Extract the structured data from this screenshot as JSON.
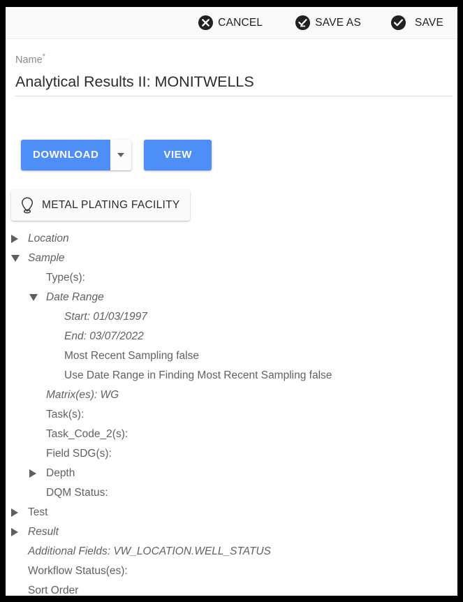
{
  "toolbar": {
    "buttons": [
      {
        "label": "CANCEL",
        "icon": "cancel-circle-icon"
      },
      {
        "label": "SAVE AS",
        "icon": "save-as-check-circle-icon"
      },
      {
        "label": "SAVE",
        "icon": "check-circle-icon"
      }
    ]
  },
  "name_field": {
    "label": "Name",
    "required_marker": "*",
    "value": "Analytical Results II: MONITWELLS",
    "placeholder": "Name"
  },
  "actions": {
    "download_label": "DOWNLOAD",
    "download_dropdown_icon": "chevron-down-icon",
    "view_label": "VIEW"
  },
  "facility_chip": {
    "label": "METAL PLATING FACILITY",
    "icon": "location-pin-icon"
  },
  "tree": {
    "nodes": [
      {
        "label": "Location",
        "indent": 0,
        "toggle": "collapsed",
        "italic": true
      },
      {
        "label": "Sample",
        "indent": 0,
        "toggle": "expanded",
        "italic": true
      },
      {
        "label": "Type(s):",
        "indent": 1,
        "toggle": "none",
        "italic": false
      },
      {
        "label": "Date Range",
        "indent": 1,
        "toggle": "expanded",
        "italic": true
      },
      {
        "label": "Start: 01/03/1997",
        "indent": 2,
        "toggle": "none",
        "italic": true
      },
      {
        "label": "End: 03/07/2022",
        "indent": 2,
        "toggle": "none",
        "italic": true
      },
      {
        "label": "Most Recent Sampling false",
        "indent": 2,
        "toggle": "none",
        "italic": false
      },
      {
        "label": "Use Date Range in Finding Most Recent Sampling false",
        "indent": 2,
        "toggle": "none",
        "italic": false
      },
      {
        "label": "Matrix(es): WG",
        "indent": 1,
        "toggle": "none",
        "italic": true
      },
      {
        "label": "Task(s):",
        "indent": 1,
        "toggle": "none",
        "italic": false
      },
      {
        "label": "Task_Code_2(s):",
        "indent": 1,
        "toggle": "none",
        "italic": false
      },
      {
        "label": "Field SDG(s):",
        "indent": 1,
        "toggle": "none",
        "italic": false
      },
      {
        "label": "Depth",
        "indent": 1,
        "toggle": "collapsed",
        "italic": false
      },
      {
        "label": "DQM Status:",
        "indent": 1,
        "toggle": "none",
        "italic": false
      },
      {
        "label": "Test",
        "indent": 0,
        "toggle": "collapsed",
        "italic": false
      },
      {
        "label": "Result",
        "indent": 0,
        "toggle": "collapsed",
        "italic": true
      },
      {
        "label": "Additional Fields: VW_LOCATION.WELL_STATUS",
        "indent": 0,
        "toggle": "none",
        "italic": true
      },
      {
        "label": "Workflow Status(es):",
        "indent": 0,
        "toggle": "none",
        "italic": false
      },
      {
        "label": "Sort Order",
        "indent": 0,
        "toggle": "none",
        "italic": false
      }
    ]
  },
  "colors": {
    "accent_blue": "#4e8ef7",
    "toolbar_bg": "#fafafa",
    "text_gray": "#616161",
    "label_gray": "#8c8c8c",
    "frame_black": "#000000"
  }
}
